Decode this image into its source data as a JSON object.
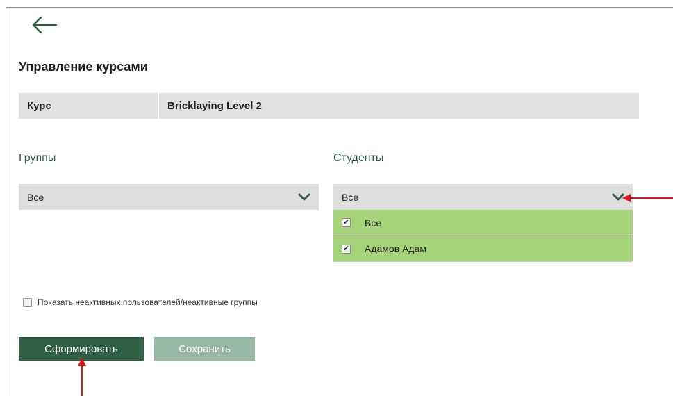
{
  "header": {
    "back_icon": "arrow-left-icon"
  },
  "page": {
    "title": "Управление курсами"
  },
  "course": {
    "label": "Курс",
    "value": "Bricklaying Level 2"
  },
  "groups": {
    "label": "Группы",
    "selected": "Все"
  },
  "students": {
    "label": "Студенты",
    "selected": "Все",
    "options": [
      {
        "label": "Все",
        "checked": true
      },
      {
        "label": "Адамов Адам",
        "checked": true
      }
    ]
  },
  "inactive": {
    "label": "Показать неактивных пользователей/неактивные группы",
    "checked": false
  },
  "actions": {
    "generate_label": "Сформировать",
    "save_label": "Сохранить"
  },
  "colors": {
    "primary": "#2f5f45",
    "disabled": "#97b8a4",
    "dropdown_bg": "#a6d47a",
    "select_bg": "#dedede",
    "annotation": "#e0151b"
  }
}
